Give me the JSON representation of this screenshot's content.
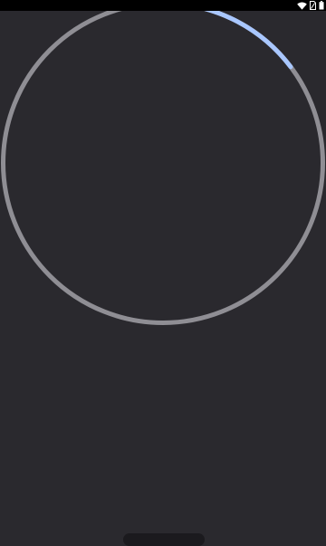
{
  "status_bar": {
    "icons": [
      "wifi-icon",
      "sim-card-icon",
      "battery-icon"
    ]
  },
  "progress": {
    "fraction": 0.125,
    "track_color": "#8f8e94",
    "indicator_color": "#a9c7ff"
  },
  "navigation": {
    "handle_color": "#1b1a1e"
  },
  "colors": {
    "background": "#2a292e",
    "status_bar": "#000000"
  }
}
